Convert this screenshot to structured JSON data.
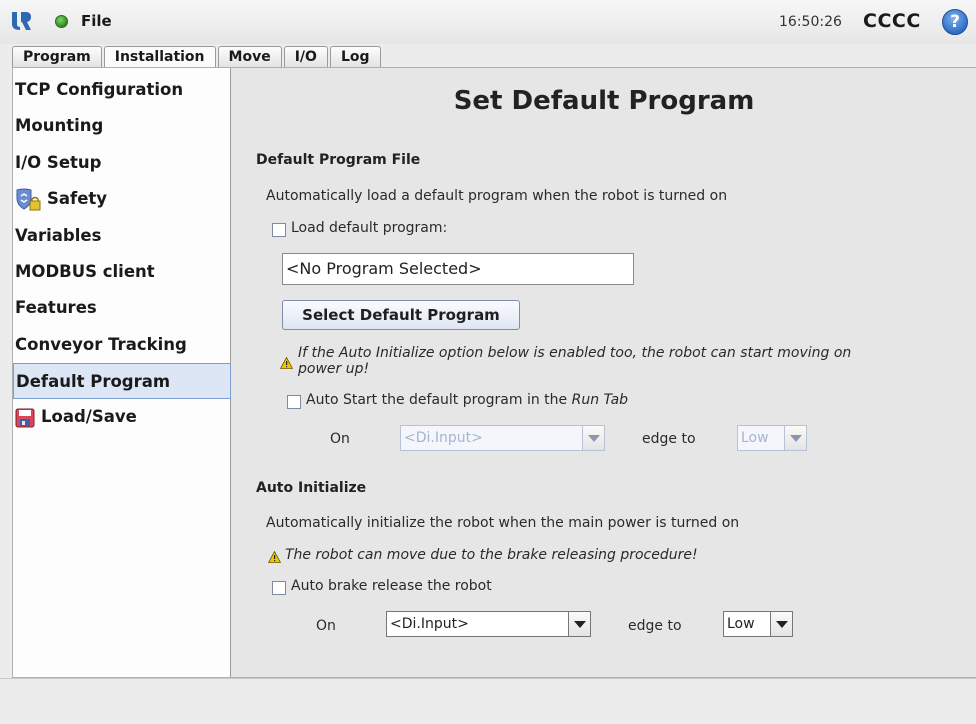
{
  "topbar": {
    "file_label": "File",
    "clock": "16:50:26",
    "robot_name": "CCCC",
    "help_glyph": "?"
  },
  "tabs": [
    {
      "label": "Program",
      "active": false
    },
    {
      "label": "Installation",
      "active": true
    },
    {
      "label": "Move",
      "active": false
    },
    {
      "label": "I/O",
      "active": false
    },
    {
      "label": "Log",
      "active": false
    }
  ],
  "sidebar": {
    "items": [
      {
        "label": "TCP Configuration"
      },
      {
        "label": "Mounting"
      },
      {
        "label": "I/O Setup"
      },
      {
        "label": "Safety",
        "icon": "shield-lock-icon"
      },
      {
        "label": "Variables"
      },
      {
        "label": "MODBUS client"
      },
      {
        "label": "Features"
      },
      {
        "label": "Conveyor Tracking"
      },
      {
        "label": "Default Program",
        "selected": true
      },
      {
        "label": "Load/Save",
        "icon": "floppy-disk-icon"
      }
    ]
  },
  "main": {
    "title": "Set Default Program",
    "default_program": {
      "section_title": "Default Program File",
      "description": "Automatically load a default program when the robot is turned on",
      "load_checkbox_label": "Load default program:",
      "load_checked": false,
      "program_field_value": "<No Program Selected>",
      "select_button_label": "Select Default Program",
      "warning_line1": "If the Auto Initialize option below is enabled too, the robot can start moving on",
      "warning_line2": "power up!",
      "autostart_label_prefix": "Auto Start the default program in the ",
      "autostart_label_tab": "Run Tab",
      "autostart_checked": false,
      "on_label": "On",
      "input_value": "<Di.Input>",
      "edge_label": "edge to",
      "edge_value": "Low"
    },
    "auto_initialize": {
      "section_title": "Auto Initialize",
      "description": "Automatically initialize the robot when the main power is turned on",
      "warning": "The robot can move due to the brake releasing procedure!",
      "brake_checkbox_label": "Auto brake release the robot",
      "brake_checked": false,
      "on_label": "On",
      "input_value": "<Di.Input>",
      "edge_label": "edge to",
      "edge_value": "Low"
    }
  },
  "colors": {
    "selection": "#dde6f5",
    "selection_border": "#7f9fd3",
    "status_ok": "#2e8b1e",
    "help": "#2f6dc6",
    "warning": "#f2c400"
  }
}
